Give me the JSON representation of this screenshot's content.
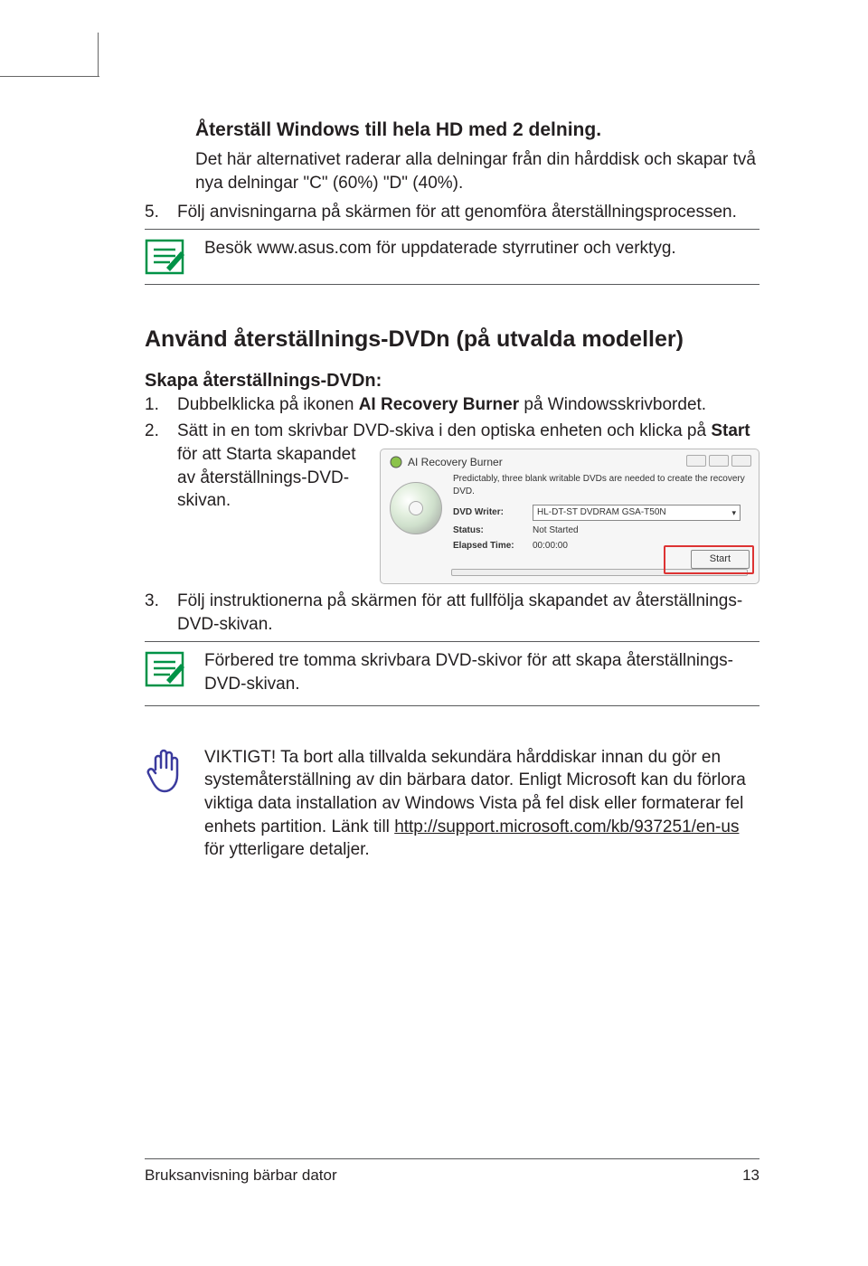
{
  "section1": {
    "heading": "Återställ Windows till hela HD med 2 delning.",
    "para": "Det här alternativet raderar alla delningar från din hårddisk och skapar två nya delningar \"C\" (60%) \"D\" (40%).",
    "step5_num": "5.",
    "step5_text": "Följ anvisningarna på skärmen för att genomföra återställningsprocessen.",
    "note": "Besök www.asus.com för uppdaterade styrrutiner och verktyg."
  },
  "section2": {
    "heading": "Använd återställnings-DVDn (på utvalda modeller)",
    "subheading": "Skapa återställnings-DVDn:",
    "step1_num": "1.",
    "step1_pre": "Dubbelklicka på ikonen ",
    "step1_bold": "AI Recovery Burner",
    "step1_post": " på Windowsskrivbordet.",
    "step2_num": "2.",
    "step2_lead": "Sätt in en tom skrivbar DVD-skiva i den optiska enheten och ",
    "step2_wrap_pre": "klicka på ",
    "step2_bold": "Start",
    "step2_wrap_post": " för att Starta skapandet av återställnings-DVD-skivan.",
    "step3_num": "3.",
    "step3_text": "Följ instruktionerna på skärmen för att fullfölja skapandet av återställnings-DVD-skivan.",
    "note2": "Förbered tre tomma skrivbara DVD-skivor för att skapa återställnings-DVD-skivan.",
    "important_pre": "VIKTIGT! Ta bort alla tillvalda sekundära hårddiskar innan du gör en systemåterställning av din bärbara dator. Enligt Microsoft kan du förlora viktiga data installation av Windows Vista på fel disk eller formaterar fel enhets partition. Länk till ",
    "important_link": "http://support.microsoft.com/kb/937251/en-us",
    "important_post": " för ytterligare detaljer."
  },
  "screenshot": {
    "title": "AI Recovery Burner",
    "desc": "Predictably, three blank writable DVDs are needed to create the recovery DVD.",
    "writer_label": "DVD Writer:",
    "writer_value": "HL-DT-ST DVDRAM GSA-T50N",
    "status_label": "Status:",
    "status_value": "Not Started",
    "elapsed_label": "Elapsed Time:",
    "elapsed_value": "00:00:00",
    "start": "Start"
  },
  "footer": {
    "left": "Bruksanvisning bärbar dator",
    "right": "13"
  }
}
